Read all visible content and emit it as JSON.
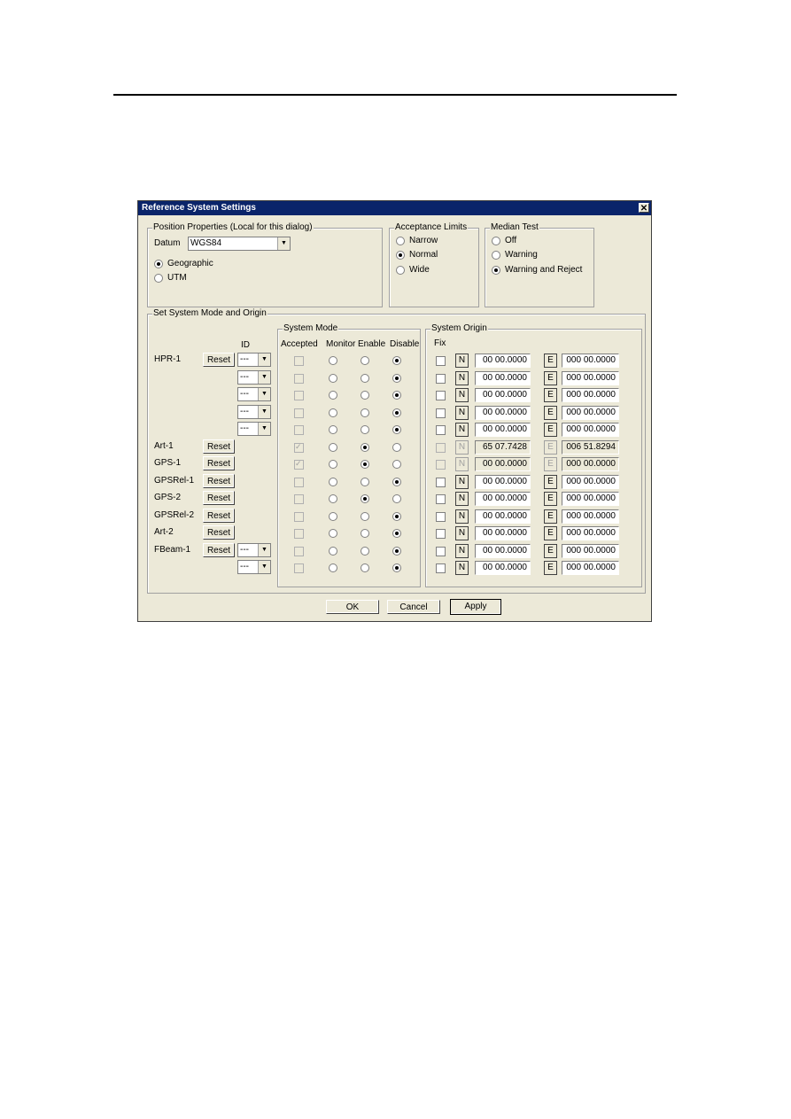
{
  "dialog": {
    "title": "Reference System Settings",
    "close_icon": "close-icon",
    "colors": {
      "title_bg": "#0a246a",
      "face": "#ece9d8"
    }
  },
  "position_properties": {
    "label": "Position Properties (Local for this dialog)",
    "datum_label": "Datum",
    "datum_value": "WGS84",
    "geographic_label": "Geographic",
    "utm_label": "UTM",
    "selected": "Geographic"
  },
  "acceptance_limits": {
    "label": "Acceptance Limits",
    "options": [
      "Narrow",
      "Normal",
      "Wide"
    ],
    "selected": "Normal"
  },
  "median_test": {
    "label": "Median Test",
    "options": [
      "Off",
      "Warning",
      "Warning and Reject"
    ],
    "selected": "Warning and Reject"
  },
  "system_group": {
    "label": "Set System Mode and Origin",
    "id_header": "ID",
    "reset_label": "Reset",
    "id_placeholder": "---",
    "mode_group_label": "System Mode",
    "mode_headers": {
      "accepted": "Accepted",
      "monitor": "Monitor",
      "enable": "Enable",
      "disable": "Disable"
    },
    "origin_group_label": "System Origin",
    "fix_header": "Fix",
    "n_label": "N",
    "e_label": "E",
    "rows": [
      {
        "name": "HPR-1",
        "reset": true,
        "combo": true,
        "mode": "disable",
        "accepted": false,
        "enabled": true,
        "n": "00 00.0000",
        "e": "000 00.0000"
      },
      {
        "name": "",
        "reset": false,
        "combo": true,
        "mode": "disable",
        "accepted": false,
        "enabled": true,
        "n": "00 00.0000",
        "e": "000 00.0000"
      },
      {
        "name": "",
        "reset": false,
        "combo": true,
        "mode": "disable",
        "accepted": false,
        "enabled": true,
        "n": "00 00.0000",
        "e": "000 00.0000"
      },
      {
        "name": "",
        "reset": false,
        "combo": true,
        "mode": "disable",
        "accepted": false,
        "enabled": true,
        "n": "00 00.0000",
        "e": "000 00.0000"
      },
      {
        "name": "",
        "reset": false,
        "combo": true,
        "mode": "disable",
        "accepted": false,
        "enabled": true,
        "n": "00 00.0000",
        "e": "000 00.0000"
      },
      {
        "name": "Art-1",
        "reset": true,
        "combo": false,
        "mode": "enable",
        "accepted": true,
        "enabled": false,
        "n": "65 07.7428",
        "e": "006 51.8294"
      },
      {
        "name": "GPS-1",
        "reset": true,
        "combo": false,
        "mode": "enable",
        "accepted": true,
        "enabled": false,
        "n": "00 00.0000",
        "e": "000 00.0000"
      },
      {
        "name": "GPSRel-1",
        "reset": true,
        "combo": false,
        "mode": "disable",
        "accepted": false,
        "enabled": true,
        "n": "00 00.0000",
        "e": "000 00.0000"
      },
      {
        "name": "GPS-2",
        "reset": true,
        "combo": false,
        "mode": "enable",
        "accepted": false,
        "enabled": true,
        "n": "00 00.0000",
        "e": "000 00.0000"
      },
      {
        "name": "GPSRel-2",
        "reset": true,
        "combo": false,
        "mode": "disable",
        "accepted": false,
        "enabled": true,
        "n": "00 00.0000",
        "e": "000 00.0000"
      },
      {
        "name": "Art-2",
        "reset": true,
        "combo": false,
        "mode": "disable",
        "accepted": false,
        "enabled": true,
        "n": "00 00.0000",
        "e": "000 00.0000"
      },
      {
        "name": "FBeam-1",
        "reset": true,
        "combo": true,
        "mode": "disable",
        "accepted": false,
        "enabled": true,
        "n": "00 00.0000",
        "e": "000 00.0000"
      },
      {
        "name": "",
        "reset": false,
        "combo": true,
        "mode": "disable",
        "accepted": false,
        "enabled": true,
        "n": "00 00.0000",
        "e": "000 00.0000"
      }
    ]
  },
  "footer": {
    "ok": "OK",
    "cancel": "Cancel",
    "apply": "Apply"
  }
}
